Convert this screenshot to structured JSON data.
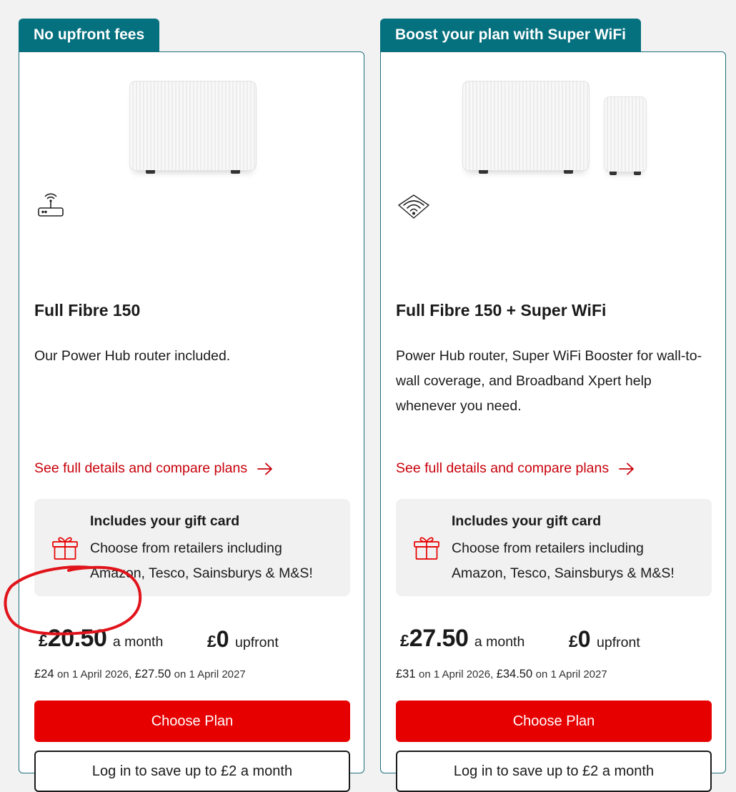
{
  "cards": [
    {
      "tag": "No upfront fees",
      "feature_icon": "router-icon",
      "title": "Full Fibre 150",
      "description": "Our Power Hub router included.",
      "details_link": "See full details and compare plans",
      "gift_title": "Includes your gift card",
      "gift_desc": "Choose from retailers including Amazon, Tesco, Sainsburys & M&S!",
      "currency": "£",
      "price": "20.50",
      "price_suffix": "a month",
      "upfront_currency": "£",
      "upfront_price": "0",
      "upfront_suffix": "upfront",
      "future_1_price": "£24",
      "future_1_date": "on 1 April 2026,",
      "future_2_price": "£27.50",
      "future_2_date": "on 1 April 2027",
      "choose_label": "Choose Plan",
      "login_label": "Log in to save up to £2 a month"
    },
    {
      "tag": "Boost your plan with Super WiFi",
      "feature_icon": "wifi-icon",
      "title": "Full Fibre 150 + Super WiFi",
      "description": "Power Hub router, Super WiFi Booster for wall-to-wall coverage, and Broadband Xpert help whenever you need.",
      "details_link": "See full details and compare plans",
      "gift_title": "Includes your gift card",
      "gift_desc": "Choose from retailers including Amazon, Tesco, Sainsburys & M&S!",
      "currency": "£",
      "price": "27.50",
      "price_suffix": "a month",
      "upfront_currency": "£",
      "upfront_price": "0",
      "upfront_suffix": "upfront",
      "future_1_price": "£31",
      "future_1_date": "on 1 April 2026,",
      "future_2_price": "£34.50",
      "future_2_date": "on 1 April 2027",
      "choose_label": "Choose Plan",
      "login_label": "Log in to save up to £2 a month"
    }
  ],
  "colors": {
    "tag_bg": "#05707e",
    "accent_red": "#e60000",
    "link_red": "#c8000a",
    "annotation_red": "#e1131b"
  }
}
